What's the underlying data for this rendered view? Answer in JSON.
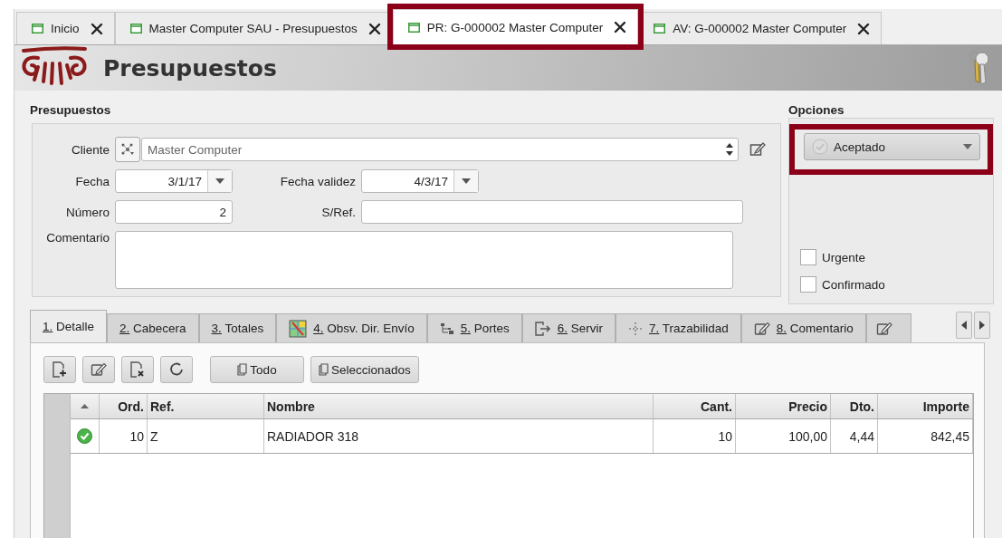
{
  "doc_tabs": [
    {
      "label": "Inicio",
      "selected": false,
      "highlighted": false
    },
    {
      "label": "Master Computer SAU - Presupuestos",
      "selected": false,
      "highlighted": false
    },
    {
      "label": "PR: G-000002 Master Computer",
      "selected": true,
      "highlighted": true
    },
    {
      "label": "AV: G-000002 Master Computer",
      "selected": false,
      "highlighted": false
    }
  ],
  "header": {
    "title": "Presupuestos"
  },
  "form": {
    "group_title": "Presupuestos",
    "cliente": {
      "label": "Cliente",
      "value": "Master Computer"
    },
    "fecha": {
      "label": "Fecha",
      "value": "3/1/17"
    },
    "fecha_validez": {
      "label": "Fecha validez",
      "value": "4/3/17"
    },
    "numero": {
      "label": "Número",
      "value": "2"
    },
    "sref": {
      "label": "S/Ref."
    },
    "comentario": {
      "label": "Comentario"
    }
  },
  "options": {
    "title": "Opciones",
    "status": {
      "value": "Aceptado",
      "highlighted": true
    },
    "checks": [
      {
        "label": "Urgente",
        "checked": false
      },
      {
        "label": "Confirmado",
        "checked": false
      }
    ]
  },
  "detail_tabs": [
    {
      "kind": "plain",
      "label": "1. Detalle",
      "selected": true
    },
    {
      "kind": "plain",
      "label": "2. Cabecera",
      "selected": false
    },
    {
      "kind": "plain",
      "label": "3. Totales",
      "selected": false
    },
    {
      "kind": "map",
      "label": "4. Obsv. Dir. Envío",
      "selected": false
    },
    {
      "kind": "tree",
      "label": "5. Portes",
      "selected": false
    },
    {
      "kind": "export",
      "label": "6. Servir",
      "selected": false
    },
    {
      "kind": "move",
      "label": "7. Trazabilidad",
      "selected": false
    },
    {
      "kind": "note",
      "label": "8. Comentario",
      "selected": false
    },
    {
      "kind": "note",
      "selected": false
    }
  ],
  "toolbar": {
    "buttons": [
      "Todo",
      "Seleccionados"
    ]
  },
  "table": {
    "columns": [
      "Ord.",
      "Ref.",
      "Nombre",
      "Cant.",
      "Precio",
      "Dto.",
      "Importe"
    ],
    "rows": [
      {
        "done": true,
        "cells": [
          "10",
          "Z",
          "RADIADOR 318",
          "10",
          "100,00",
          "4,44",
          "842,45"
        ]
      }
    ]
  }
}
